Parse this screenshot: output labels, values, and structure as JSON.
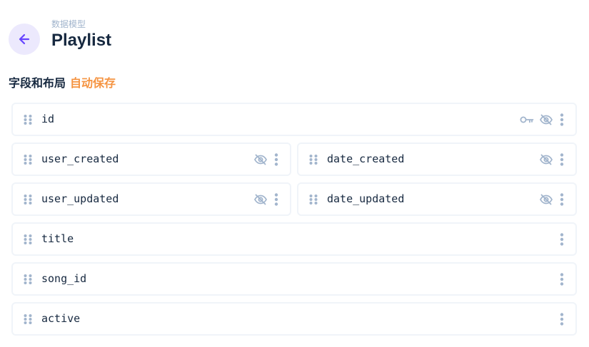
{
  "header": {
    "breadcrumb": "数据模型",
    "title": "Playlist",
    "back_icon": "arrow-left-icon"
  },
  "section": {
    "title": "字段和布局",
    "autosave_label": "自动保存"
  },
  "colors": {
    "accent": "#6644ff",
    "accent_bg": "#ece9fd",
    "autosave": "#f59442",
    "icon_gray": "#a2b5cd",
    "border": "#f0f4f9"
  },
  "fields": [
    {
      "name": "id",
      "icons": [
        "key-icon",
        "eye-off-icon",
        "more-vertical-icon"
      ]
    },
    {
      "name": "user_created",
      "icons": [
        "eye-off-icon",
        "more-vertical-icon"
      ]
    },
    {
      "name": "date_created",
      "icons": [
        "eye-off-icon",
        "more-vertical-icon"
      ]
    },
    {
      "name": "user_updated",
      "icons": [
        "eye-off-icon",
        "more-vertical-icon"
      ]
    },
    {
      "name": "date_updated",
      "icons": [
        "eye-off-icon",
        "more-vertical-icon"
      ]
    },
    {
      "name": "title",
      "icons": [
        "more-vertical-icon"
      ]
    },
    {
      "name": "song_id",
      "icons": [
        "more-vertical-icon"
      ]
    },
    {
      "name": "active",
      "icons": [
        "more-vertical-icon"
      ]
    }
  ]
}
